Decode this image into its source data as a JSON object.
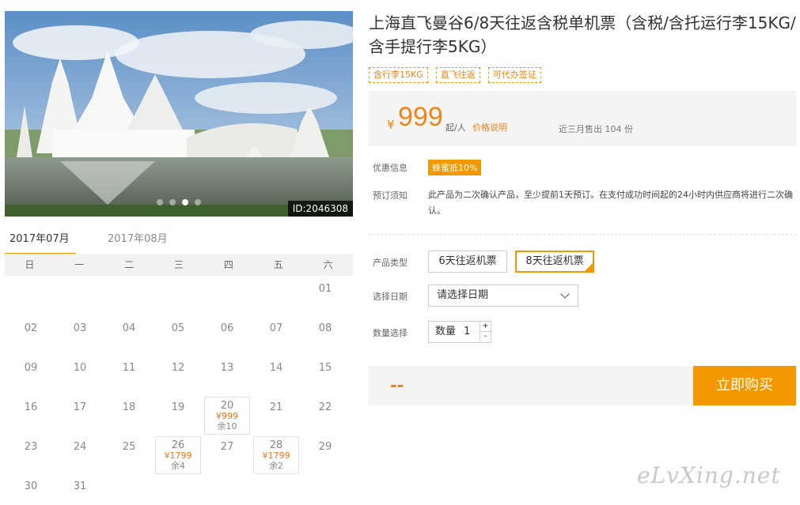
{
  "photo": {
    "id_label": "ID:2046308",
    "slides": 4,
    "active_slide": 2
  },
  "calendar": {
    "tabs": [
      {
        "label": "2017年07月",
        "active": true
      },
      {
        "label": "2017年08月",
        "active": false
      }
    ],
    "weekdays": [
      "日",
      "一",
      "二",
      "三",
      "四",
      "五",
      "六"
    ],
    "rows": [
      [
        null,
        null,
        null,
        null,
        null,
        null,
        {
          "d": "01"
        }
      ],
      [
        {
          "d": "02"
        },
        {
          "d": "03"
        },
        {
          "d": "04"
        },
        {
          "d": "05"
        },
        {
          "d": "06"
        },
        {
          "d": "07"
        },
        {
          "d": "08"
        }
      ],
      [
        {
          "d": "09"
        },
        {
          "d": "10"
        },
        {
          "d": "11"
        },
        {
          "d": "12"
        },
        {
          "d": "13"
        },
        {
          "d": "14"
        },
        {
          "d": "15"
        }
      ],
      [
        {
          "d": "16"
        },
        {
          "d": "17"
        },
        {
          "d": "18"
        },
        {
          "d": "19"
        },
        {
          "d": "20",
          "price": "¥999",
          "stock": "余10"
        },
        {
          "d": "21"
        },
        {
          "d": "22"
        }
      ],
      [
        {
          "d": "23"
        },
        {
          "d": "24"
        },
        {
          "d": "25"
        },
        {
          "d": "26",
          "price": "¥1799",
          "stock": "余4"
        },
        {
          "d": "27"
        },
        {
          "d": "28",
          "price": "¥1799",
          "stock": "余2"
        },
        {
          "d": "29"
        }
      ],
      [
        {
          "d": "30"
        },
        {
          "d": "31"
        },
        null,
        null,
        null,
        null,
        null
      ]
    ]
  },
  "product": {
    "title": "上海直飞曼谷6/8天往返含税单机票（含税/含托运行李15KG/含手提行李5KG）",
    "tags": [
      "含行李15KG",
      "直飞往返",
      "可代办签证"
    ]
  },
  "price": {
    "currency": "¥",
    "amount": "999",
    "unit": "起/人",
    "explain": "价格说明",
    "sold": "近三月售出 104 份"
  },
  "promo": {
    "label": "优惠信息",
    "badge": "蜂蜜抵10%"
  },
  "notice": {
    "label": "预订须知",
    "text": "此产品为二次确认产品，至少提前1天预订。在支付成功时间起的24小时内供应商将进行二次确认。"
  },
  "options": {
    "type_label": "产品类型",
    "types": [
      "6天往返机票",
      "8天往返机票"
    ],
    "selected_type": "8天往返机票",
    "date_label": "选择日期",
    "date_placeholder": "请选择日期",
    "qty_label_row": "数量选择",
    "qty_label": "数量",
    "qty_value": "1",
    "plus": "+",
    "minus": "-"
  },
  "buy": {
    "total": "--",
    "button": "立即购买"
  },
  "watermark": "eLvXing.net",
  "colors": {
    "accent": "#f39800",
    "price": "#f08519"
  }
}
